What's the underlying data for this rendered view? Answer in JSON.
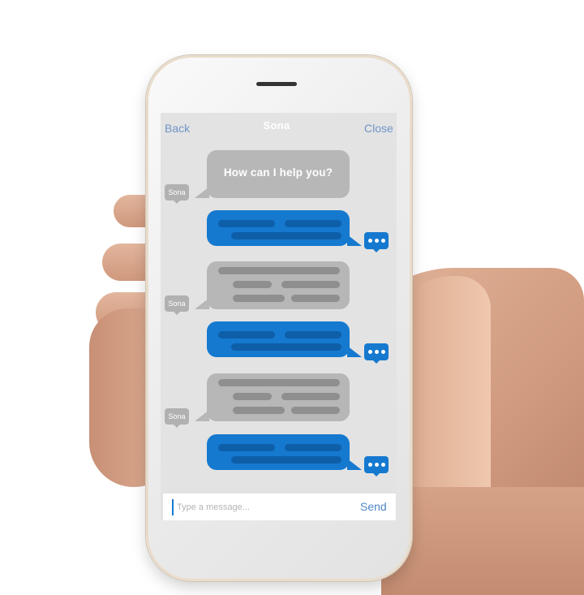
{
  "header": {
    "back_label": "Back",
    "title": "Sona",
    "close_label": "Close"
  },
  "messages": {
    "first_bot": "How can I help you?"
  },
  "avatar": {
    "bot_label": "Sona"
  },
  "composer": {
    "placeholder": "Type a message...",
    "send_label": "Send"
  },
  "colors": {
    "user_bubble": "#1579cf",
    "bot_bubble": "#b7b7b7",
    "link": "#6f95c9"
  }
}
